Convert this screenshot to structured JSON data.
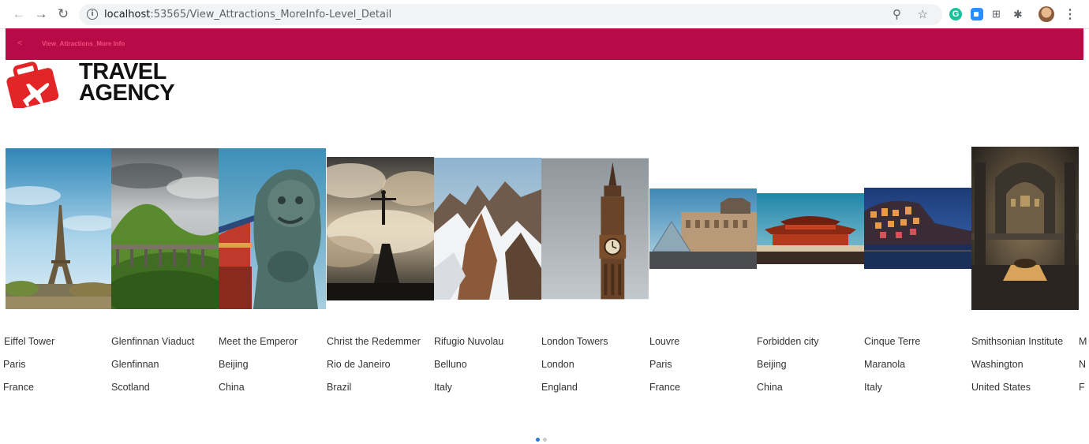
{
  "browser": {
    "url_host": "localhost",
    "url_path": ":53565/View_Attractions_MoreInfo-Level_Detail",
    "icons": [
      "back-arrow-icon",
      "forward-arrow-icon",
      "reload-icon",
      "info-icon",
      "zoom-icon",
      "star-icon",
      "grammarly-icon",
      "zoom-app-icon",
      "grid-icon",
      "puzzle-icon",
      "profile-avatar",
      "menu-icon"
    ]
  },
  "appbar": {
    "title": "View_Attractions_More Info",
    "color": "#b80a46"
  },
  "logo": {
    "line1": "TRAVEL",
    "line2": "AGENCY",
    "color": "#e42528"
  },
  "attractions": [
    {
      "name": "Eiffel Tower",
      "city": "Paris",
      "country": "France"
    },
    {
      "name": "Glenfinnan Viaduct",
      "city": "Glenfinnan",
      "country": "Scotland"
    },
    {
      "name": "Meet the Emperor",
      "city": "Beijing",
      "country": "China"
    },
    {
      "name": "Christ the Redemmer",
      "city": "Rio de Janeiro",
      "country": "Brazil"
    },
    {
      "name": "Rifugio Nuvolau",
      "city": "Belluno",
      "country": "Italy"
    },
    {
      "name": "London Towers",
      "city": "London",
      "country": "England"
    },
    {
      "name": "Louvre",
      "city": "Paris",
      "country": "France"
    },
    {
      "name": "Forbidden city",
      "city": "Beijing",
      "country": "China"
    },
    {
      "name": "Cinque Terre",
      "city": "Maranola",
      "country": "Italy"
    },
    {
      "name": "Smithsonian Institute",
      "city": "Washington",
      "country": "United States"
    },
    {
      "name": "M",
      "city": "N",
      "country": "F"
    }
  ],
  "pagination": {
    "pages": 2,
    "active": 1
  }
}
